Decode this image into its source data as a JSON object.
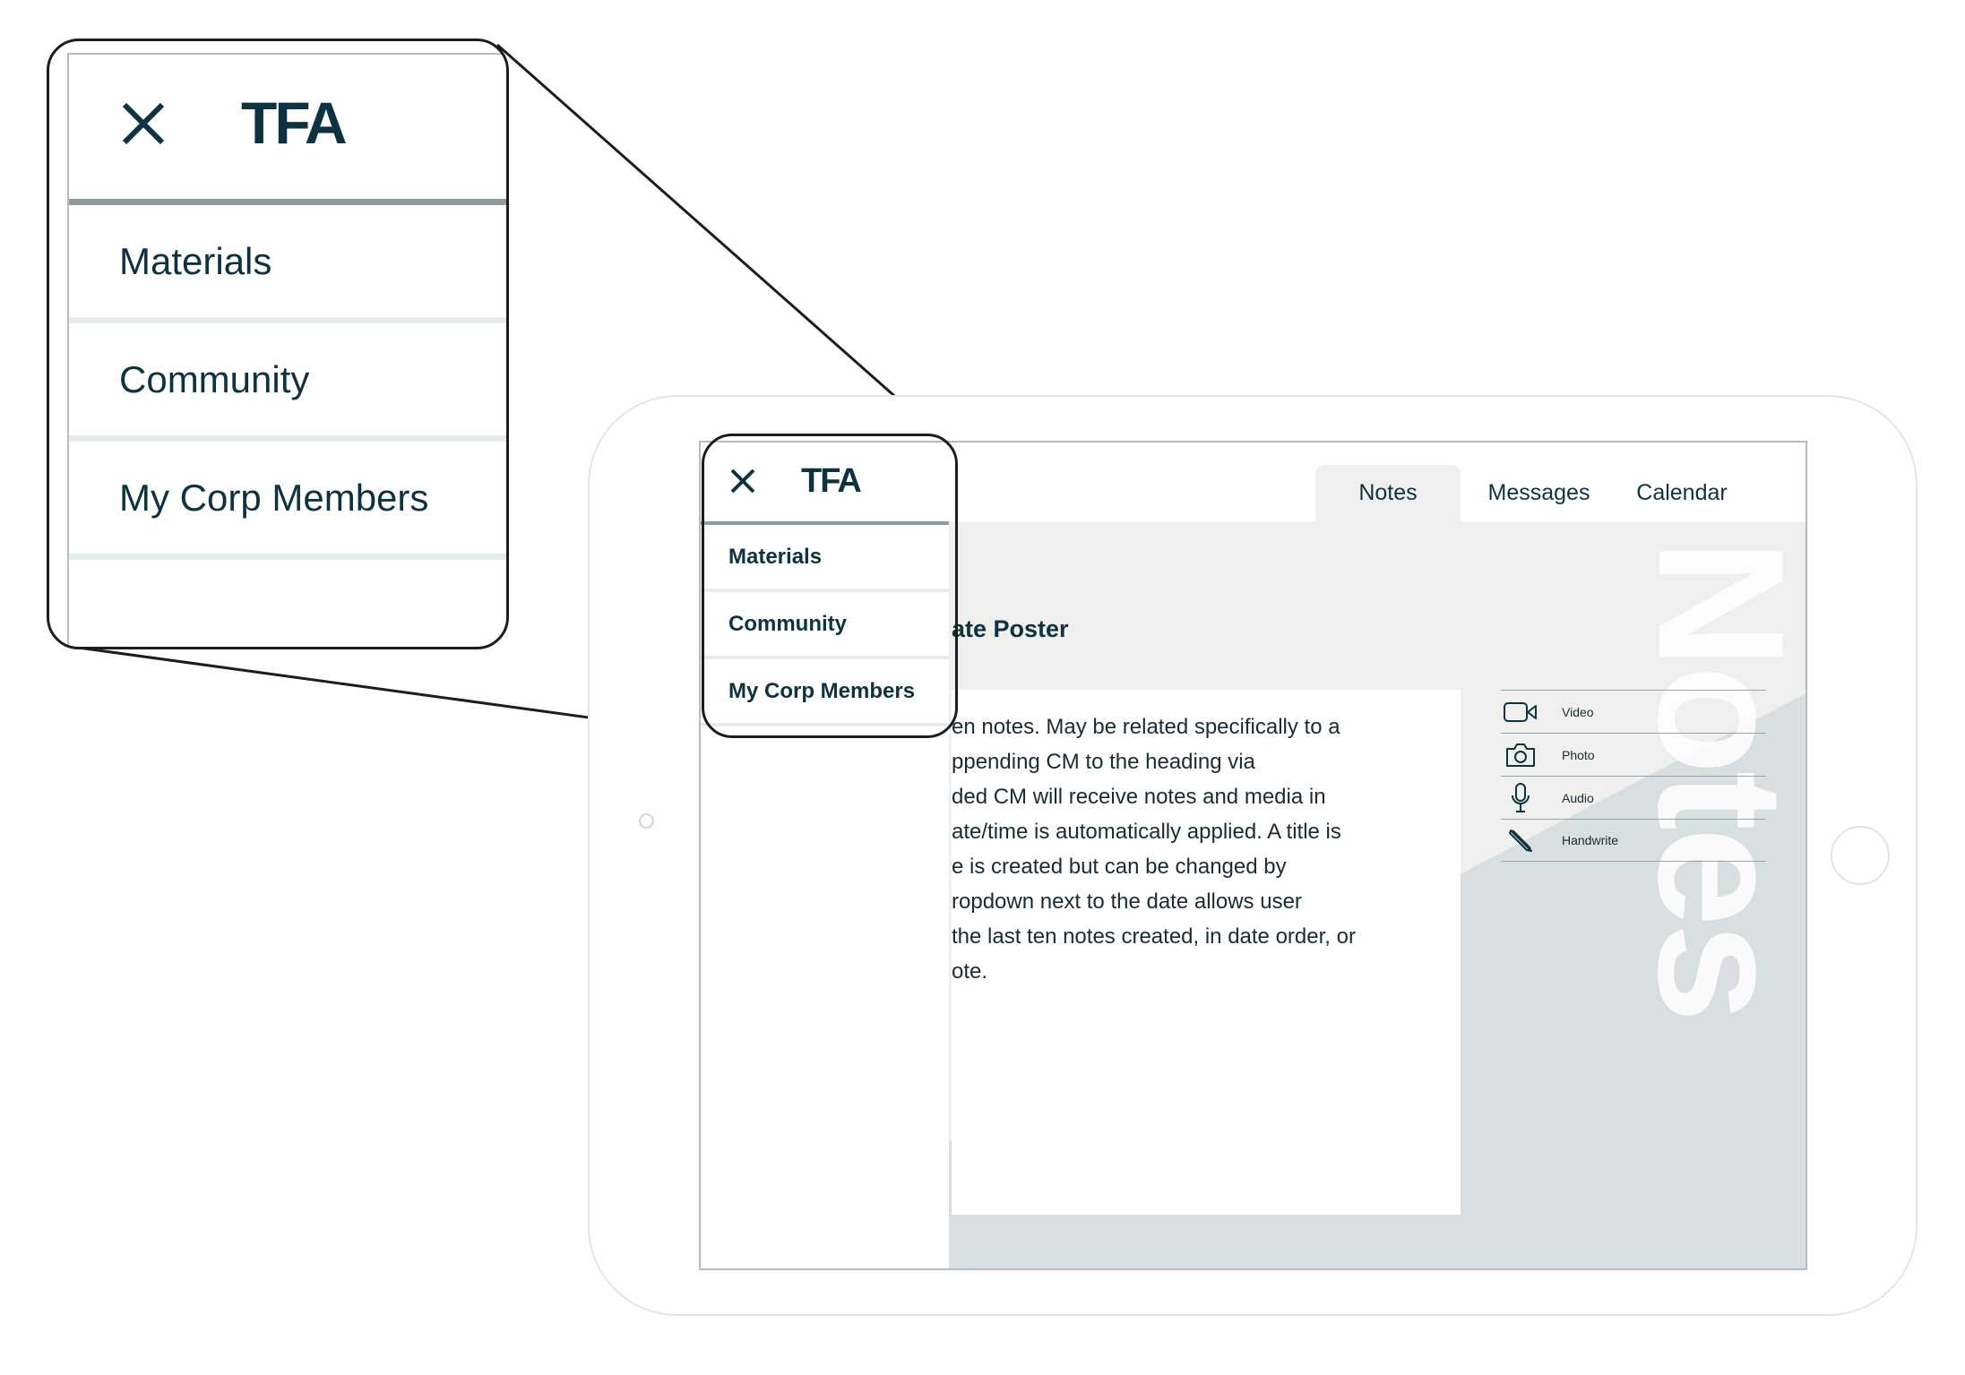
{
  "brand": {
    "logo_text": "TFA",
    "navy": "#0d3340"
  },
  "menu": {
    "close_icon": "close-icon",
    "items": [
      {
        "label": "Materials"
      },
      {
        "label": "Community"
      },
      {
        "label": "My Corp Members"
      }
    ]
  },
  "tabs": [
    {
      "label": "Notes",
      "active": true
    },
    {
      "label": "Messages",
      "active": false
    },
    {
      "label": "Calendar",
      "active": false
    }
  ],
  "note": {
    "title": "ate Poster",
    "lines": [
      "en notes. May be related specifically to a",
      "ppending CM to the heading via",
      "ded CM will receive notes and media in",
      "ate/time is automatically applied. A title is",
      "e is created but can be changed by",
      "ropdown next to the date allows user",
      "the last ten notes created, in date order, or",
      "ote."
    ]
  },
  "media_tools": [
    {
      "label": "Video",
      "icon": "video-camera-icon"
    },
    {
      "label": "Photo",
      "icon": "camera-icon"
    },
    {
      "label": "Audio",
      "icon": "microphone-icon"
    },
    {
      "label": "Handwrite",
      "icon": "pencil-icon"
    }
  ],
  "watermark": "Notes"
}
